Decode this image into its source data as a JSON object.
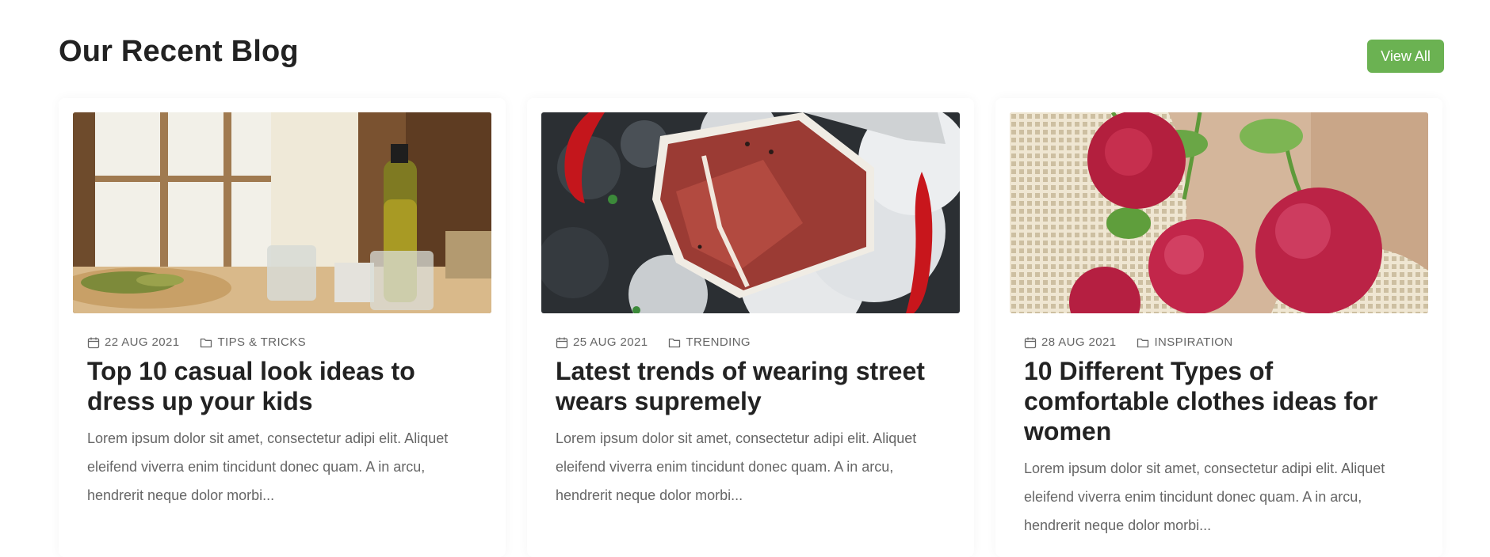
{
  "section": {
    "title": "Our Recent Blog",
    "view_all_label": "View All",
    "accent_color": "#6bb252"
  },
  "posts": [
    {
      "date": "22 AUG 2021",
      "category": "TIPS & TRICKS",
      "title": "Top 10 casual look ideas to dress up your kids",
      "excerpt": "Lorem ipsum dolor sit amet, consectetur adipi elit. Aliquet eleifend viverra enim tincidunt donec quam. A in arcu, hendrerit neque dolor morbi...",
      "image": "restaurant-table-olive-oil"
    },
    {
      "date": "25 AUG 2021",
      "category": "TRENDING",
      "title": "Latest trends of wearing street wears supremely",
      "excerpt": "Lorem ipsum dolor sit amet, consectetur adipi elit. Aliquet eleifend viverra enim tincidunt donec quam. A in arcu, hendrerit neque dolor morbi...",
      "image": "t-bone-steak-on-ice"
    },
    {
      "date": "28 AUG 2021",
      "category": "INSPIRATION",
      "title": "10 Different Types of comfortable clothes ideas for women",
      "excerpt": "Lorem ipsum dolor sit amet, consectetur adipi elit. Aliquet eleifend viverra enim tincidunt donec quam. A in arcu, hendrerit neque dolor morbi...",
      "image": "radishes-in-mesh-bag"
    }
  ],
  "icons": {
    "date": "calendar-icon",
    "category": "folder-icon"
  }
}
